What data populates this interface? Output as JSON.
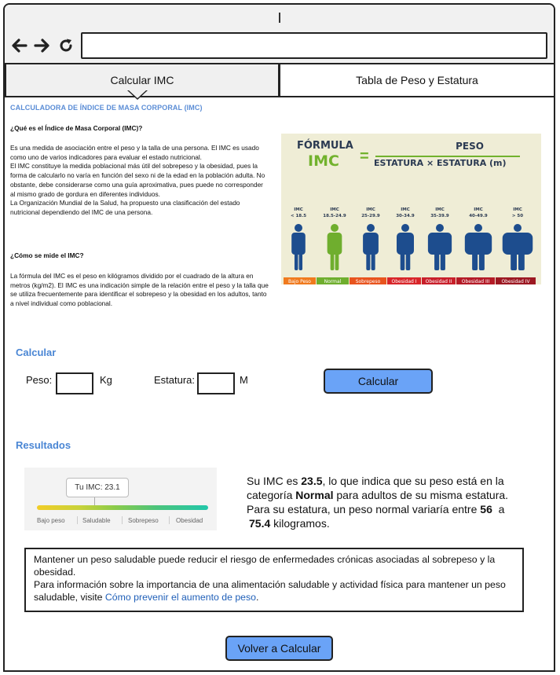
{
  "browser": {
    "back_icon": "arrow-left-icon",
    "forward_icon": "arrow-right-icon",
    "reload_icon": "reload-icon",
    "address": ""
  },
  "tabs": [
    {
      "label": "Calcular IMC",
      "active": true
    },
    {
      "label": "Tabla de Peso y Estatura",
      "active": false
    }
  ],
  "article": {
    "heading": "CALCULADORA DE ÍNDICE DE MASA CORPORAL (IMC)",
    "q1": "¿Qué es el Índice de Masa Corporal (IMC)?",
    "p1": "Es una medida de asociación entre el peso y la talla de una persona. El IMC es usado como uno de varios indicadores para evaluar el estado nutricional.\nEl IMC constituye la medida poblacional más útil del sobrepeso y la obesidad, pues la forma de calcularlo no varía en función del sexo ni de la edad en la población adulta. No obstante, debe considerarse como una guía aproximativa, pues puede no corresponder al mismo grado de gordura en diferentes individuos.\nLa Organización Mundial de la Salud, ha propuesto una clasificación del estado nutricional dependiendo del IMC de una persona.",
    "q2": "¿Cómo se mide el IMC?",
    "p2": "La fórmula del IMC es el peso en kilógramos dividido por el cuadrado de la altura en metros (kg/m2). El IMC es una indicación simple de la relación entre el peso y la talla que se utiliza frecuentemente para identificar el sobrepeso y la obesidad en los adultos, tanto a nivel individual como poblacional."
  },
  "infographic": {
    "formula_word": "FÓRMULA",
    "imc": "IMC",
    "equals": "=",
    "numerator": "PESO",
    "denominator": "ESTATURA × ESTATURA (m)",
    "ranges": [
      {
        "label": "IMC",
        "range": "< 18.5",
        "category": "Bajo Peso",
        "color": "#f07a1e"
      },
      {
        "label": "IMC",
        "range": "18.5-24.9",
        "category": "Normal",
        "color": "#6fae2e"
      },
      {
        "label": "IMC",
        "range": "25-29.9",
        "category": "Sobrepeso",
        "color": "#e8541e"
      },
      {
        "label": "IMC",
        "range": "30-34.9",
        "category": "Obesidad I",
        "color": "#d8262a"
      },
      {
        "label": "IMC",
        "range": "35-39.9",
        "category": "Obesidad II",
        "color": "#c81f2a"
      },
      {
        "label": "IMC",
        "range": "40-49.9",
        "category": "Obesidad III",
        "color": "#b41b27"
      },
      {
        "label": "IMC",
        "range": "> 50",
        "category": "Obesidad IV",
        "color": "#9c1822"
      }
    ]
  },
  "calc": {
    "title": "Calcular",
    "weight_label": "Peso:",
    "weight_unit": "Kg",
    "weight_value": "",
    "height_label": "Estatura:",
    "height_unit": "M",
    "height_value": "",
    "button": "Calcular"
  },
  "results": {
    "title": "Resultados",
    "gauge": {
      "tooltip": "Tu IMC: 23.1",
      "labels": [
        "Bajo peso",
        "Saludable",
        "Sobrepeso",
        "Obesidad"
      ]
    },
    "t1": "Su IMC es ",
    "imc": "23.5",
    "t2": ", lo que indica que su peso está en la categoría ",
    "category": "Normal",
    "t3": " para adultos de su misma estatura. Para su estatura, un peso normal variaría entre ",
    "min": "56",
    "t4": "  a  ",
    "max": "75.4",
    "t5": " kilogramos."
  },
  "note": {
    "line1": "Mantener un peso saludable puede reducir el riesgo de enfermedades crónicas asociadas al sobrepeso y la obesidad.",
    "line2": "Para información sobre la importancia de una alimentación saludable y actividad física para mantener un peso saludable, visite ",
    "link": "Cómo prevenir el aumento de peso",
    "end": "."
  },
  "back_button": "Volver a Calcular",
  "colors": {
    "accent_blue": "#6aa3f7",
    "heading_blue": "#4a86d4",
    "link_blue": "#1f5fb8",
    "figure_blue": "#1d4d8e",
    "figure_green": "#6fae2e"
  }
}
